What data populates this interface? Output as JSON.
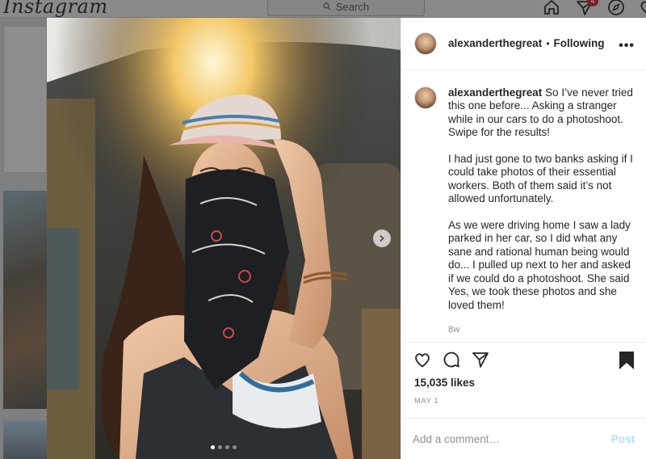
{
  "app": {
    "logo_text": "Instagram"
  },
  "topnav": {
    "search_placeholder": "Search",
    "notification_count": "4",
    "icons": [
      "home-icon",
      "direct-icon",
      "explore-icon",
      "activity-icon"
    ]
  },
  "post": {
    "author": "alexanderthegreat",
    "follow_separator": "•",
    "follow_status": "Following",
    "more_label": "•••",
    "caption_paragraphs": [
      "So I’ve never tried this one before... Asking a stranger while in our cars to do a photoshoot. Swipe for the results!",
      "I had just gone to two banks asking if I could take photos of their essential workers. Both of them said it’s not allowed unfortunately.",
      "As we were driving home I saw a lady parked in her car, so I did what any sane and rational human being would do... I pulled up next to her and asked if we could do a photoshoot. She said Yes, we took these photos and she loved them!"
    ],
    "caption_age": "8w",
    "likes": "15,035 likes",
    "date": "MAY 1",
    "carousel": {
      "total": 4,
      "active_index": 0
    },
    "saved": true
  },
  "comment": {
    "placeholder": "Add a comment…",
    "post_label": "Post"
  },
  "colors": {
    "accent_blue_disabled": "#b2dffc",
    "muted": "#8e8e8e",
    "border": "#efefef"
  }
}
